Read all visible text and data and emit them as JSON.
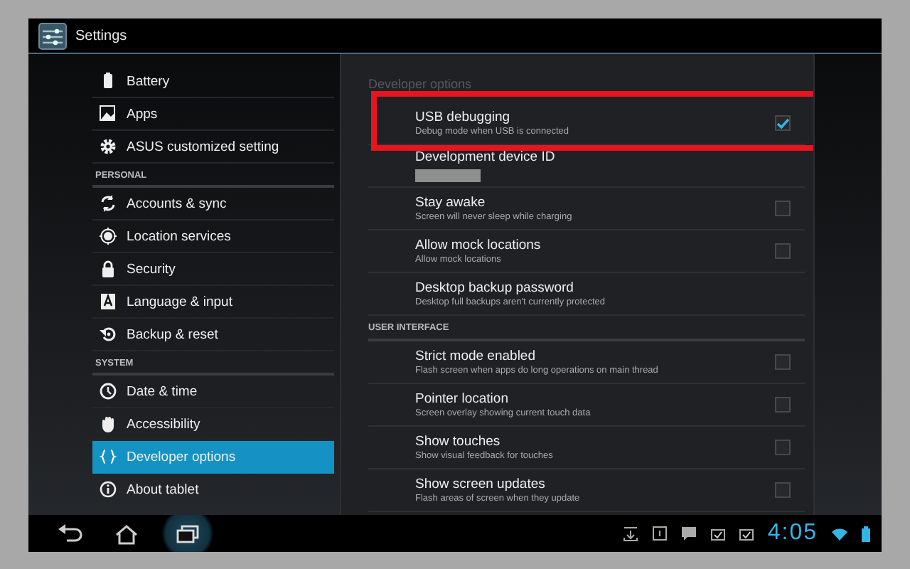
{
  "window": {
    "title": "Settings"
  },
  "sidebar": {
    "items": [
      {
        "kind": "item",
        "label": "Battery",
        "selected": false
      },
      {
        "kind": "item",
        "label": "Apps",
        "selected": false
      },
      {
        "kind": "item",
        "label": "ASUS customized setting",
        "selected": false
      },
      {
        "kind": "header",
        "label": "PERSONAL"
      },
      {
        "kind": "item",
        "label": "Accounts & sync",
        "selected": false
      },
      {
        "kind": "item",
        "label": "Location services",
        "selected": false
      },
      {
        "kind": "item",
        "label": "Security",
        "selected": false
      },
      {
        "kind": "item",
        "label": "Language & input",
        "selected": false
      },
      {
        "kind": "item",
        "label": "Backup & reset",
        "selected": false
      },
      {
        "kind": "header",
        "label": "SYSTEM"
      },
      {
        "kind": "item",
        "label": "Date & time",
        "selected": false
      },
      {
        "kind": "item",
        "label": "Accessibility",
        "selected": false
      },
      {
        "kind": "item",
        "label": "Developer options",
        "selected": true
      },
      {
        "kind": "item",
        "label": "About tablet",
        "selected": false
      }
    ]
  },
  "panel": {
    "title": "Developer options",
    "items": [
      {
        "kind": "check",
        "title": "USB debugging",
        "subtitle": "Debug mode when USB is connected",
        "checked": true,
        "highlighted": true
      },
      {
        "kind": "value",
        "title": "Development device ID",
        "redacted": true
      },
      {
        "kind": "check",
        "title": "Stay awake",
        "subtitle": "Screen will never sleep while charging",
        "checked": false,
        "highlighted": false
      },
      {
        "kind": "check",
        "title": "Allow mock locations",
        "subtitle": "Allow mock locations",
        "checked": false,
        "highlighted": false
      },
      {
        "kind": "action",
        "title": "Desktop backup password",
        "subtitle": "Desktop full backups aren't currently protected"
      },
      {
        "kind": "header",
        "title": "USER INTERFACE"
      },
      {
        "kind": "check",
        "title": "Strict mode enabled",
        "subtitle": "Flash screen when apps do long operations on main thread",
        "checked": false,
        "highlighted": false
      },
      {
        "kind": "check",
        "title": "Pointer location",
        "subtitle": "Screen overlay showing current touch data",
        "checked": false,
        "highlighted": false
      },
      {
        "kind": "check",
        "title": "Show touches",
        "subtitle": "Show visual feedback for touches",
        "checked": false,
        "highlighted": false
      },
      {
        "kind": "check",
        "title": "Show screen updates",
        "subtitle": "Flash areas of screen when they update",
        "checked": false,
        "highlighted": false
      }
    ]
  },
  "navigation": {
    "buttons": [
      {
        "selected": false
      },
      {
        "selected": false
      },
      {
        "selected": true
      }
    ]
  },
  "status_bar": {
    "time": "4:05"
  }
}
